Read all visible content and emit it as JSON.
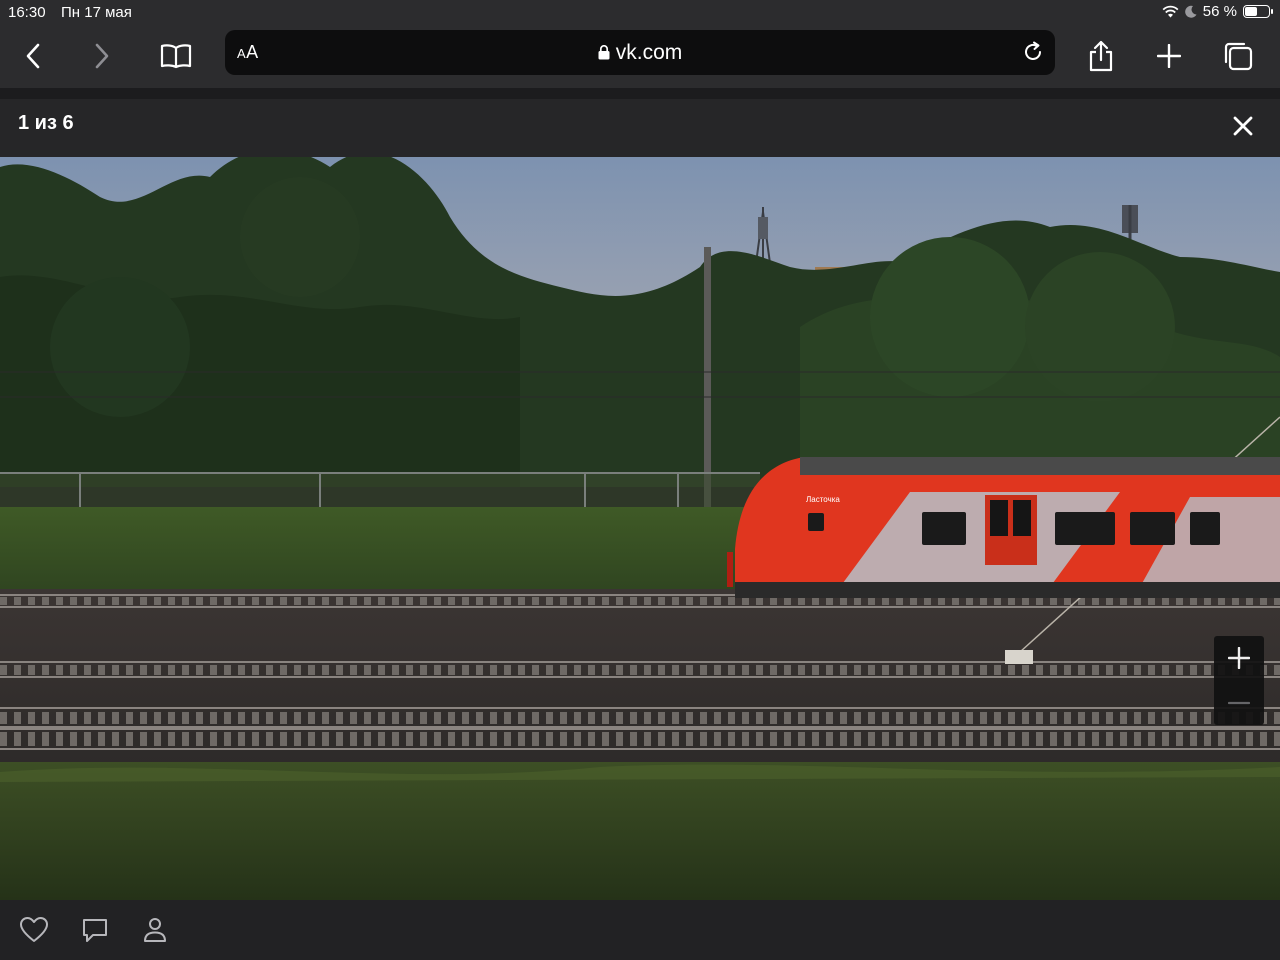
{
  "status_bar": {
    "time": "16:30",
    "date": "Пн 17 мая",
    "battery_text": "56 %",
    "battery_level": 0.56,
    "icons": [
      "wifi-icon",
      "moon-icon",
      "battery-icon"
    ]
  },
  "toolbar": {
    "back_icon": "chevron-left-icon",
    "forward_icon": "chevron-right-icon",
    "bookmarks_icon": "book-icon",
    "reader_label_small": "A",
    "reader_label_large": "A",
    "lock_icon": "lock-icon",
    "domain": "vk.com",
    "reload_icon": "reload-icon",
    "share_icon": "share-icon",
    "new_tab_icon": "plus-icon",
    "tabs_icon": "tabs-icon"
  },
  "viewer": {
    "counter": "1 из 6",
    "close_icon": "close-icon",
    "photo_description_text": "Ласточка",
    "zoom_in_icon": "plus-icon",
    "zoom_out_icon": "minus-icon"
  },
  "actions": {
    "like_icon": "heart-icon",
    "comment_icon": "comment-icon",
    "tag_icon": "person-icon"
  },
  "colors": {
    "chrome": "#2c2c2e",
    "url_field": "#0d0d0e",
    "train_red": "#e0361f",
    "sky": "#8ea1bb"
  }
}
